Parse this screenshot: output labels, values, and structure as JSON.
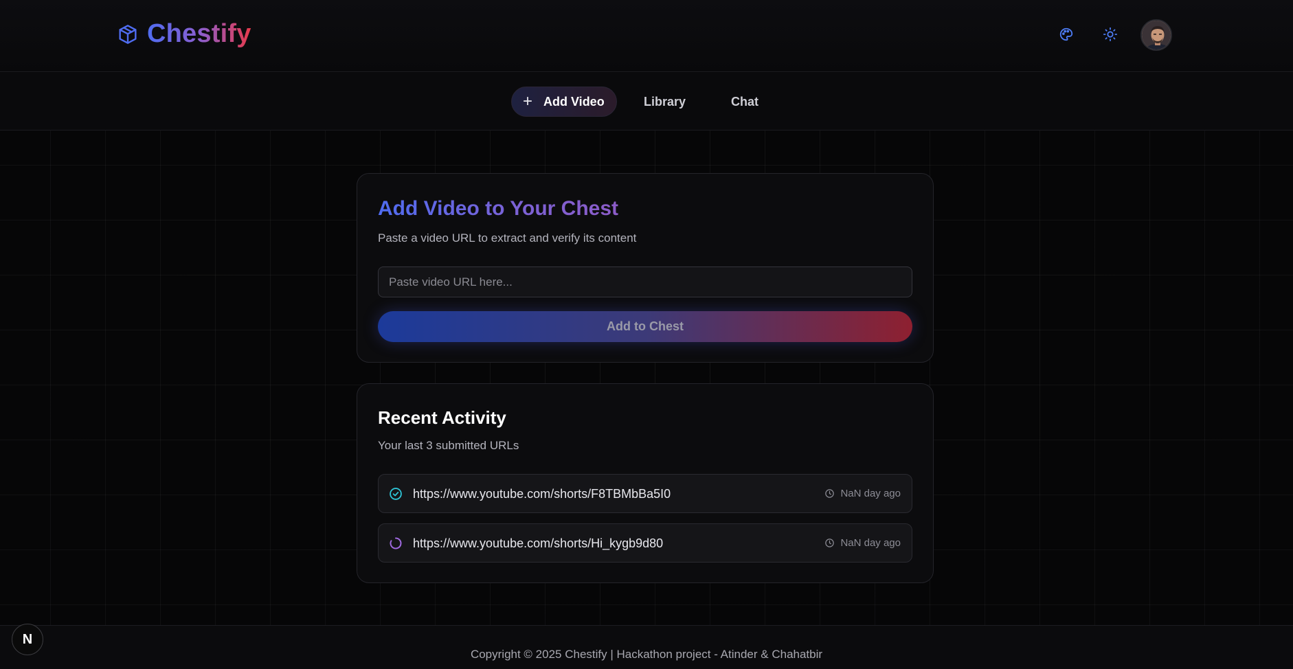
{
  "header": {
    "brand": "Chestify",
    "brand_icon": "package-cube-icon",
    "icons": [
      "palette-icon",
      "sun-icon"
    ],
    "avatar": "user-avatar"
  },
  "nav": {
    "tabs": [
      {
        "label": "Add Video",
        "active": true,
        "icon": "plus-icon"
      },
      {
        "label": "Library",
        "active": false
      },
      {
        "label": "Chat",
        "active": false
      }
    ]
  },
  "add_card": {
    "title": "Add Video to Your Chest",
    "subtitle": "Paste a video URL to extract and verify its content",
    "input_placeholder": "Paste video URL here...",
    "input_value": "",
    "button_label": "Add to Chest"
  },
  "activity": {
    "title": "Recent Activity",
    "subtitle": "Your last 3 submitted URLs",
    "items": [
      {
        "url": "https://www.youtube.com/shorts/F8TBMbBa5I0",
        "time": "NaN day ago",
        "status": "completed",
        "status_icon": "check-circle-icon"
      },
      {
        "url": "https://www.youtube.com/shorts/Hi_kygb9d80",
        "time": "NaN day ago",
        "status": "processing",
        "status_icon": "loading-spinner-icon"
      }
    ]
  },
  "footer": {
    "text": "Copyright © 2025 Chestify | Hackathon project - Atinder & Chahatbir",
    "badge": "N"
  },
  "colors": {
    "brand_blue": "#4f6cf0",
    "brand_red": "#e8394a",
    "completed": "#2ec4d6",
    "processing": "#a06ae0"
  }
}
